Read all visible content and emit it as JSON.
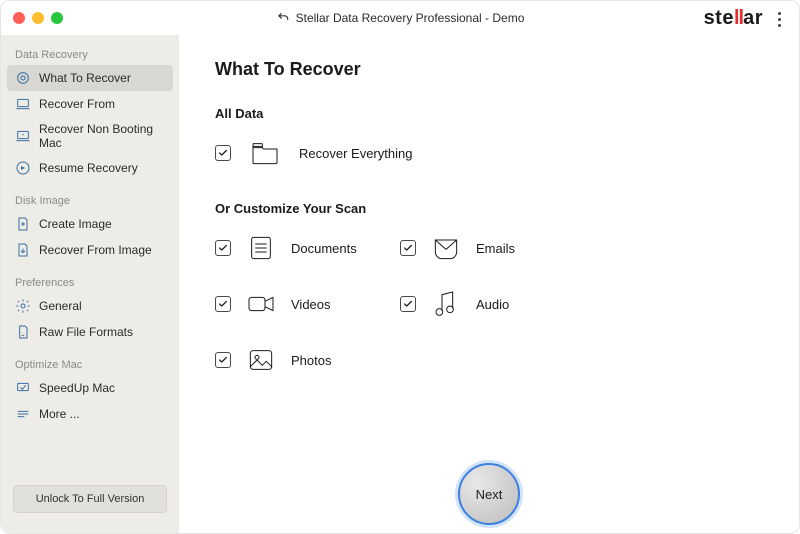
{
  "window_title": "Stellar Data Recovery Professional - Demo",
  "brand": {
    "pre": "ste",
    "accent": "ll",
    "post": "ar"
  },
  "sidebar": {
    "sections": {
      "data_recovery": "Data Recovery",
      "disk_image": "Disk Image",
      "preferences": "Preferences",
      "optimize_mac": "Optimize Mac"
    },
    "items": {
      "what_to_recover": "What To Recover",
      "recover_from": "Recover From",
      "recover_non_booting": "Recover Non Booting Mac",
      "resume_recovery": "Resume Recovery",
      "create_image": "Create Image",
      "recover_from_image": "Recover From Image",
      "general": "General",
      "raw_file_formats": "Raw File Formats",
      "speedup_mac": "SpeedUp Mac",
      "more": "More ..."
    },
    "unlock": "Unlock To Full Version"
  },
  "main": {
    "title": "What To Recover",
    "all_data_label": "All Data",
    "recover_everything": "Recover Everything",
    "customize_label": "Or Customize Your Scan",
    "options": {
      "documents": "Documents",
      "emails": "Emails",
      "videos": "Videos",
      "audio": "Audio",
      "photos": "Photos"
    },
    "next": "Next"
  }
}
